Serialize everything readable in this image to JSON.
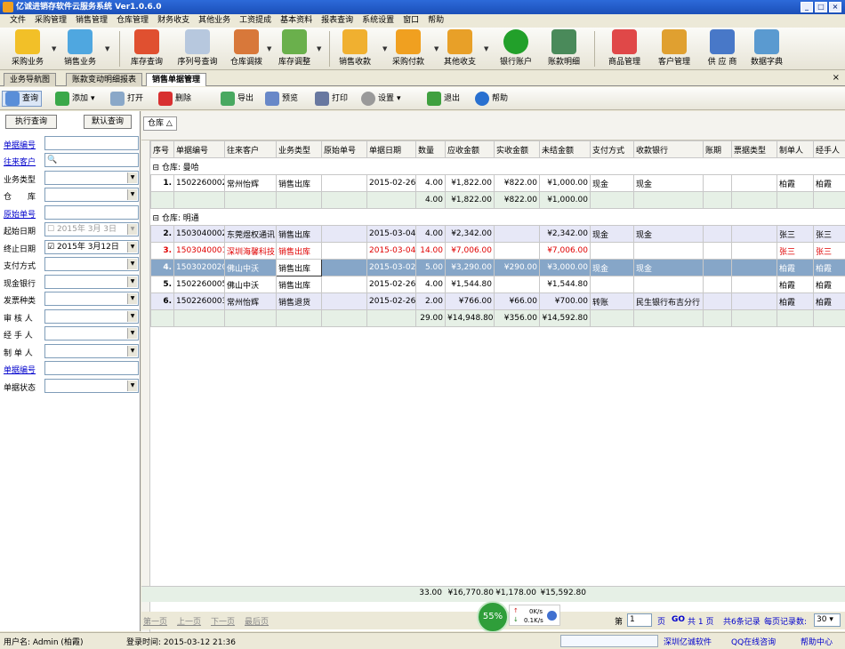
{
  "title": "亿诚进销存软件云服务系统 Ver1.0.6.0",
  "menu": [
    "文件",
    "采购管理",
    "销售管理",
    "仓库管理",
    "财务收支",
    "其他业务",
    "工资提成",
    "基本资料",
    "报表查询",
    "系统设置",
    "窗口",
    "帮助"
  ],
  "toolbar": [
    "采购业务",
    "销售业务",
    "库存查询",
    "序列号查询",
    "仓库调拨",
    "库存调整",
    "销售收款",
    "采购付款",
    "其他收支",
    "银行账户",
    "账款明细",
    "商品管理",
    "客户管理",
    "供 应 商",
    "数据字典"
  ],
  "tabs": [
    "业务导航图",
    "账款变动明细报表",
    "销售单据管理"
  ],
  "subtool": [
    "查询",
    "添加",
    "打开",
    "删除",
    "导出",
    "预览",
    "打印",
    "设置",
    "退出",
    "帮助"
  ],
  "left": {
    "btn_query": "执行查询",
    "btn_default": "默认查询",
    "fields": [
      "单据编号",
      "往来客户",
      "业务类型",
      "仓　　库",
      "原始单号",
      "起始日期",
      "终止日期",
      "支付方式",
      "现金银行",
      "发票种类",
      "审 核 人",
      "经 手 人",
      "制 单 人",
      "单据编号",
      "单据状态"
    ],
    "start_date": "2015年 3月 3日",
    "end_date": "2015年 3月12日"
  },
  "group_chip": "仓库 △",
  "columns": [
    "序号",
    "单据编号",
    "往来客户",
    "业务类型",
    "原始单号",
    "单据日期",
    "数量",
    "应收金额",
    "实收金额",
    "未结金额",
    "支付方式",
    "收款银行",
    "账期",
    "票据类型",
    "制单人",
    "经手人"
  ],
  "groups": [
    {
      "label": "仓库: 曼哈",
      "rows": [
        [
          "1.",
          "1502260002",
          "常州怡辉",
          "销售出库",
          "",
          "2015-02-26",
          "4.00",
          "¥1,822.00",
          "¥822.00",
          "¥1,000.00",
          "现金",
          "现金",
          "",
          "",
          "柏霞",
          "柏霞"
        ]
      ],
      "sum": [
        "4.00",
        "¥1,822.00",
        "¥822.00",
        "¥1,000.00"
      ]
    },
    {
      "label": "仓库: 明通",
      "rows": [
        [
          "2.",
          "1503040002",
          "东莞煜权通讯",
          "销售出库",
          "",
          "2015-03-04",
          "4.00",
          "¥2,342.00",
          "",
          "¥2,342.00",
          "现金",
          "现金",
          "",
          "",
          "张三",
          "张三"
        ],
        [
          "3.",
          "1503040001",
          "深圳海馨科技",
          "销售出库",
          "",
          "2015-03-04",
          "14.00",
          "¥7,006.00",
          "",
          "¥7,006.00",
          "",
          "",
          "",
          "",
          "张三",
          "张三"
        ],
        [
          "4.",
          "1503020020",
          "佛山中沃",
          "销售出库",
          "",
          "2015-03-02",
          "5.00",
          "¥3,290.00",
          "¥290.00",
          "¥3,000.00",
          "现金",
          "现金",
          "",
          "",
          "柏霞",
          "柏霞"
        ],
        [
          "5.",
          "1502260005",
          "佛山中沃",
          "销售出库",
          "",
          "2015-02-26",
          "4.00",
          "¥1,544.80",
          "",
          "¥1,544.80",
          "",
          "",
          "",
          "",
          "柏霞",
          "柏霞"
        ],
        [
          "6.",
          "1502260003",
          "常州怡辉",
          "销售退货",
          "",
          "2015-02-26",
          "2.00",
          "¥766.00",
          "¥66.00",
          "¥700.00",
          "转账",
          "民生银行布吉分行",
          "",
          "",
          "柏霞",
          "柏霞"
        ]
      ],
      "sum": [
        "29.00",
        "¥14,948.80",
        "¥356.00",
        "¥14,592.80"
      ]
    }
  ],
  "total": [
    "33.00",
    "¥16,770.80",
    "¥1,178.00",
    "¥15,592.80"
  ],
  "pager": {
    "first": "第一页",
    "prev": "上一页",
    "next": "下一页",
    "last": "最后页",
    "page_label": "第",
    "page": "1",
    "page_unit": "页",
    "go": "GO",
    "total_pages": "共 1 页",
    "total_records": "共6条记录",
    "per_page_label": "每页记录数:",
    "per_page": "30"
  },
  "speed": {
    "pct": "55%",
    "up": "0K/s",
    "down": "0.1K/s"
  },
  "status": {
    "user": "用户名: Admin (柏霞)",
    "login": "登录时间: 2015-03-12 21:36",
    "company": "深圳亿诚软件",
    "qq": "QQ在线咨询",
    "help": "帮助中心"
  }
}
